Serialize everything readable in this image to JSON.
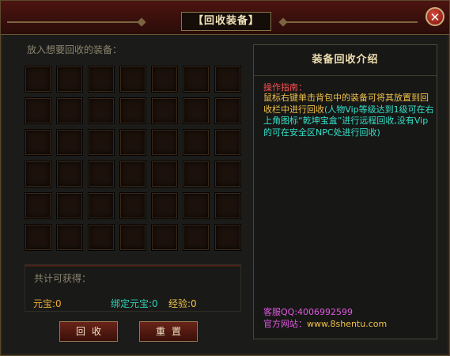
{
  "window": {
    "title": "【回收装备】",
    "close_glyph": "✕"
  },
  "left": {
    "prompt": "放入想要回收的装备：",
    "grid": {
      "rows": 6,
      "cols": 7
    }
  },
  "rewards": {
    "title": "共计可获得：",
    "yuanbao": "元宝:0",
    "bound_yuanbao": "绑定元宝:0",
    "exp": "经验:0"
  },
  "buttons": {
    "recycle": "回收",
    "reset": "重置"
  },
  "panel": {
    "title": "装备回收介绍",
    "guide_title": "操作指南：",
    "guide_line1": "鼠标右键单击背包中的装备可将其放置到回收栏中进行回收",
    "guide_line2": "(人物Vip等级达到1级可在右上角图标“乾坤宝盒”进行远程回收,没有Vip的可在安全区NPC处进行回收)",
    "qq": "客服QQ:4006992599",
    "site_label": "官方网站：",
    "site_url": "www.8shentu.com"
  },
  "colors": {
    "yellow": "#f0c24a",
    "cyan": "#34e0c8",
    "magenta": "#e05ae0",
    "red": "#ff5050",
    "reward_yuanbao": "#f0b030",
    "reward_bound": "#30d0b8",
    "reward_exp": "#f0c24a"
  }
}
